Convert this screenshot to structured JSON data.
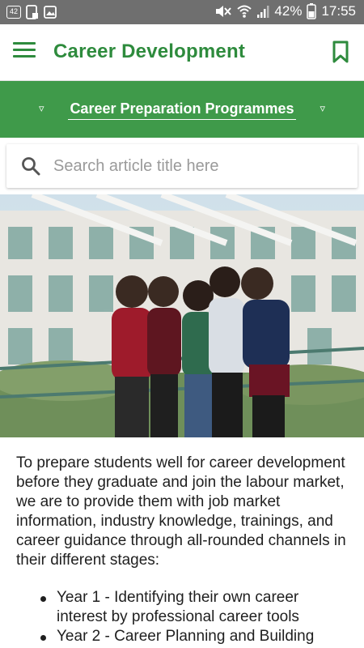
{
  "status_bar": {
    "notification_badge": "42",
    "battery": "42%",
    "time": "17:55"
  },
  "header": {
    "title": "Career Development",
    "menu_icon": "hamburger-menu-icon",
    "bookmark_icon": "bookmark-icon"
  },
  "category": {
    "label": "Career Preparation Programmes",
    "prev_arrow": "▿",
    "next_arrow": "▿"
  },
  "search": {
    "placeholder": "Search article title here"
  },
  "article": {
    "intro": "To prepare students well for career development before they graduate and join the labour market, we are to provide them with job market information, industry knowledge, trainings, and career guidance through all-rounded channels in their different stages:",
    "bullets": [
      "Year 1 - Identifying their own career interest by professional career tools",
      "Year 2 - Career Planning and Building"
    ]
  },
  "colors": {
    "brand_green": "#2e8b3d",
    "band_green": "#3f9a4a",
    "status_gray": "#6f6f6f"
  }
}
